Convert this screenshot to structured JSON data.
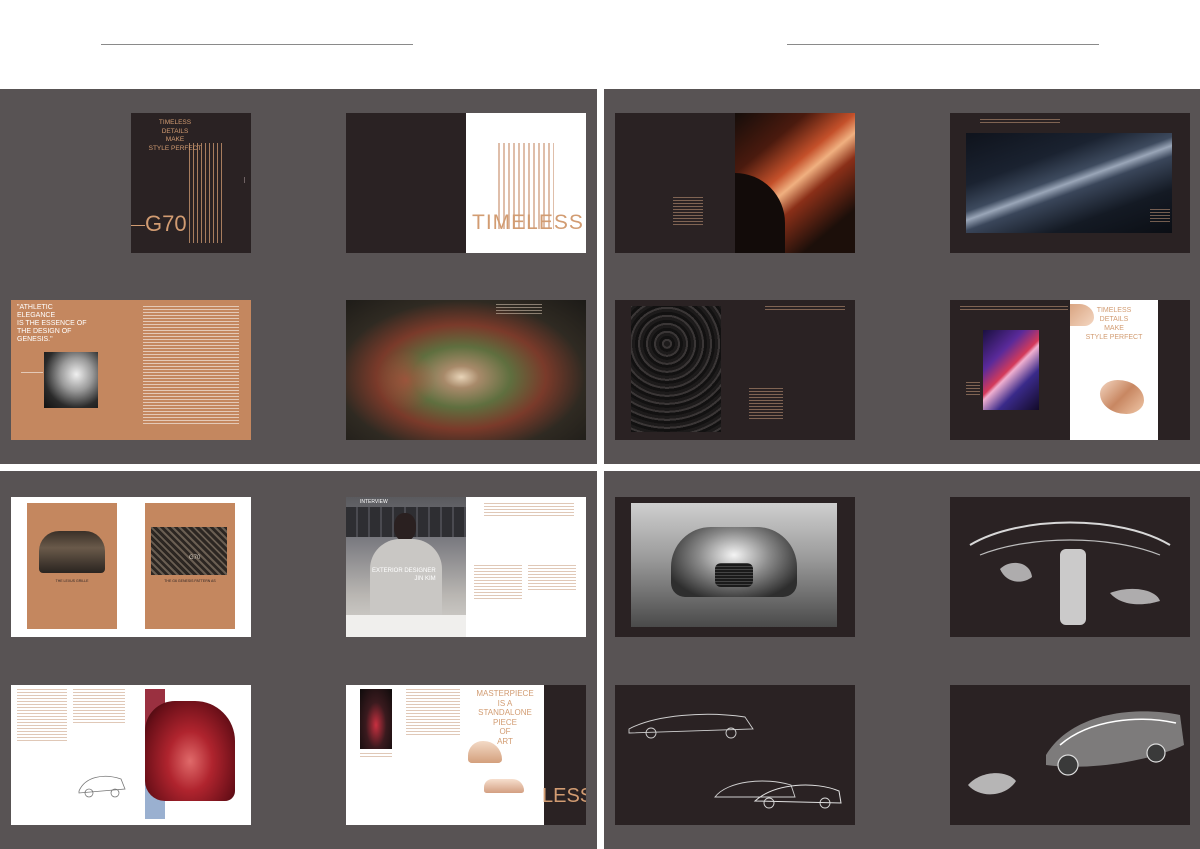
{
  "colors": {
    "background": "#ffffff",
    "panel": "#585354",
    "dark_page": "#2a2223",
    "tan_page": "#c4875f",
    "copper_text": "#d29c72"
  },
  "spread_timeless": {
    "lines": [
      "TIMELESS",
      "DETAILS",
      "MAKE",
      "STYLE PERFECT"
    ],
    "model": "G70"
  },
  "spread_timeless_word": {
    "word": "TIMELESS"
  },
  "spread_athletic": {
    "quote": [
      "\"ATHLETIC",
      "ELEGANCE",
      "IS THE ESSENCE OF",
      "THE DESIGN OF",
      "GENESIS.\""
    ]
  },
  "spread_timeless_right": {
    "lines": [
      "TIMELESS",
      "DETAILS",
      "MAKE",
      "STYLE PERFECT"
    ]
  },
  "spread_grille": {
    "caption_left": "THE LEXUS GRILLE",
    "caption_right": "THE G6 GENESIS PATTERN AS",
    "badge": "G70"
  },
  "spread_interview": {
    "lines": [
      "EXTERIOR DESIGNER",
      "JIN KIM"
    ],
    "top_label": "INTERVIEW"
  },
  "spread_masterpiece": {
    "lines": [
      "MASTERPIECE",
      "IS A",
      "STANDALONE",
      "PIECE",
      "OF",
      "ART"
    ],
    "word": "LESS"
  }
}
